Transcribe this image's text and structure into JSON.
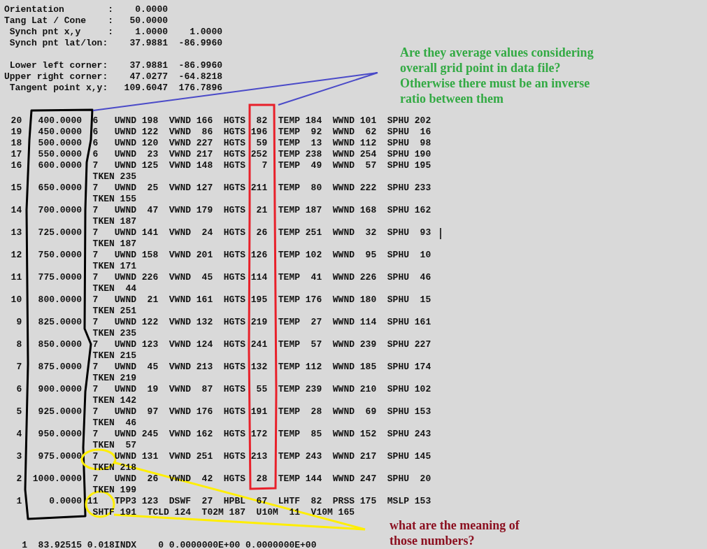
{
  "projection": [
    {
      "label": "Orientation        :",
      "values": [
        "0.0000"
      ]
    },
    {
      "label": "Tang Lat / Cone    :",
      "values": [
        "50.0000"
      ]
    },
    {
      "label": " Synch pnt x,y     :",
      "values": [
        "1.0000",
        "1.0000"
      ]
    },
    {
      "label": " Synch pnt lat/lon:",
      "values": [
        "37.9881",
        "-86.9960"
      ]
    }
  ],
  "corners": [
    {
      "label": " Lower left corner:",
      "values": [
        "37.9881",
        "-86.9960"
      ]
    },
    {
      "label": "Upper right corner:",
      "values": [
        "47.0277",
        "-64.8218"
      ]
    },
    {
      "label": " Tangent point x,y:",
      "values": [
        "109.6047",
        "176.7896"
      ]
    }
  ],
  "levels": [
    {
      "index": "20",
      "pressure": "400.0000",
      "count": "6",
      "fields": [
        {
          "name": "UWND",
          "value": "198"
        },
        {
          "name": "VWND",
          "value": "166"
        },
        {
          "name": "HGTS",
          "value": "82"
        },
        {
          "name": "TEMP",
          "value": "184"
        },
        {
          "name": "WWND",
          "value": "101"
        },
        {
          "name": "SPHU",
          "value": "202"
        }
      ]
    },
    {
      "index": "19",
      "pressure": "450.0000",
      "count": "6",
      "fields": [
        {
          "name": "UWND",
          "value": "122"
        },
        {
          "name": "VWND",
          "value": "86"
        },
        {
          "name": "HGTS",
          "value": "196"
        },
        {
          "name": "TEMP",
          "value": "92"
        },
        {
          "name": "WWND",
          "value": "62"
        },
        {
          "name": "SPHU",
          "value": "16"
        }
      ]
    },
    {
      "index": "18",
      "pressure": "500.0000",
      "count": "6",
      "fields": [
        {
          "name": "UWND",
          "value": "120"
        },
        {
          "name": "VWND",
          "value": "227"
        },
        {
          "name": "HGTS",
          "value": "59"
        },
        {
          "name": "TEMP",
          "value": "13"
        },
        {
          "name": "WWND",
          "value": "112"
        },
        {
          "name": "SPHU",
          "value": "98"
        }
      ]
    },
    {
      "index": "17",
      "pressure": "550.0000",
      "count": "6",
      "fields": [
        {
          "name": "UWND",
          "value": "23"
        },
        {
          "name": "VWND",
          "value": "217"
        },
        {
          "name": "HGTS",
          "value": "252"
        },
        {
          "name": "TEMP",
          "value": "238"
        },
        {
          "name": "WWND",
          "value": "254"
        },
        {
          "name": "SPHU",
          "value": "190"
        }
      ]
    },
    {
      "index": "16",
      "pressure": "600.0000",
      "count": "7",
      "fields": [
        {
          "name": "UWND",
          "value": "125"
        },
        {
          "name": "VWND",
          "value": "148"
        },
        {
          "name": "HGTS",
          "value": "7"
        },
        {
          "name": "TEMP",
          "value": "49"
        },
        {
          "name": "WWND",
          "value": "57"
        },
        {
          "name": "SPHU",
          "value": "195"
        }
      ],
      "continuation": [
        {
          "name": "TKEN",
          "value": "235"
        }
      ]
    },
    {
      "index": "15",
      "pressure": "650.0000",
      "count": "7",
      "fields": [
        {
          "name": "UWND",
          "value": "25"
        },
        {
          "name": "VWND",
          "value": "127"
        },
        {
          "name": "HGTS",
          "value": "211"
        },
        {
          "name": "TEMP",
          "value": "80"
        },
        {
          "name": "WWND",
          "value": "222"
        },
        {
          "name": "SPHU",
          "value": "233"
        }
      ],
      "continuation": [
        {
          "name": "TKEN",
          "value": "155"
        }
      ]
    },
    {
      "index": "14",
      "pressure": "700.0000",
      "count": "7",
      "fields": [
        {
          "name": "UWND",
          "value": "47"
        },
        {
          "name": "VWND",
          "value": "179"
        },
        {
          "name": "HGTS",
          "value": "21"
        },
        {
          "name": "TEMP",
          "value": "187"
        },
        {
          "name": "WWND",
          "value": "168"
        },
        {
          "name": "SPHU",
          "value": "162"
        }
      ],
      "continuation": [
        {
          "name": "TKEN",
          "value": "187"
        }
      ]
    },
    {
      "index": "13",
      "pressure": "725.0000",
      "count": "7",
      "fields": [
        {
          "name": "UWND",
          "value": "141"
        },
        {
          "name": "VWND",
          "value": "24"
        },
        {
          "name": "HGTS",
          "value": "26"
        },
        {
          "name": "TEMP",
          "value": "251"
        },
        {
          "name": "WWND",
          "value": "32"
        },
        {
          "name": "SPHU",
          "value": "93"
        }
      ],
      "continuation": [
        {
          "name": "TKEN",
          "value": "187"
        }
      ]
    },
    {
      "index": "12",
      "pressure": "750.0000",
      "count": "7",
      "fields": [
        {
          "name": "UWND",
          "value": "158"
        },
        {
          "name": "VWND",
          "value": "201"
        },
        {
          "name": "HGTS",
          "value": "126"
        },
        {
          "name": "TEMP",
          "value": "102"
        },
        {
          "name": "WWND",
          "value": "95"
        },
        {
          "name": "SPHU",
          "value": "10"
        }
      ],
      "continuation": [
        {
          "name": "TKEN",
          "value": "171"
        }
      ]
    },
    {
      "index": "11",
      "pressure": "775.0000",
      "count": "7",
      "fields": [
        {
          "name": "UWND",
          "value": "226"
        },
        {
          "name": "VWND",
          "value": "45"
        },
        {
          "name": "HGTS",
          "value": "114"
        },
        {
          "name": "TEMP",
          "value": "41"
        },
        {
          "name": "WWND",
          "value": "226"
        },
        {
          "name": "SPHU",
          "value": "46"
        }
      ],
      "continuation": [
        {
          "name": "TKEN",
          "value": "44"
        }
      ]
    },
    {
      "index": "10",
      "pressure": "800.0000",
      "count": "7",
      "fields": [
        {
          "name": "UWND",
          "value": "21"
        },
        {
          "name": "VWND",
          "value": "161"
        },
        {
          "name": "HGTS",
          "value": "195"
        },
        {
          "name": "TEMP",
          "value": "176"
        },
        {
          "name": "WWND",
          "value": "180"
        },
        {
          "name": "SPHU",
          "value": "15"
        }
      ],
      "continuation": [
        {
          "name": "TKEN",
          "value": "251"
        }
      ]
    },
    {
      "index": "9",
      "pressure": "825.0000",
      "count": "7",
      "fields": [
        {
          "name": "UWND",
          "value": "122"
        },
        {
          "name": "VWND",
          "value": "132"
        },
        {
          "name": "HGTS",
          "value": "219"
        },
        {
          "name": "TEMP",
          "value": "27"
        },
        {
          "name": "WWND",
          "value": "114"
        },
        {
          "name": "SPHU",
          "value": "161"
        }
      ],
      "continuation": [
        {
          "name": "TKEN",
          "value": "235"
        }
      ]
    },
    {
      "index": "8",
      "pressure": "850.0000",
      "count": "7",
      "fields": [
        {
          "name": "UWND",
          "value": "123"
        },
        {
          "name": "VWND",
          "value": "124"
        },
        {
          "name": "HGTS",
          "value": "241"
        },
        {
          "name": "TEMP",
          "value": "57"
        },
        {
          "name": "WWND",
          "value": "239"
        },
        {
          "name": "SPHU",
          "value": "227"
        }
      ],
      "continuation": [
        {
          "name": "TKEN",
          "value": "215"
        }
      ]
    },
    {
      "index": "7",
      "pressure": "875.0000",
      "count": "7",
      "fields": [
        {
          "name": "UWND",
          "value": "45"
        },
        {
          "name": "VWND",
          "value": "213"
        },
        {
          "name": "HGTS",
          "value": "132"
        },
        {
          "name": "TEMP",
          "value": "112"
        },
        {
          "name": "WWND",
          "value": "185"
        },
        {
          "name": "SPHU",
          "value": "174"
        }
      ],
      "continuation": [
        {
          "name": "TKEN",
          "value": "219"
        }
      ]
    },
    {
      "index": "6",
      "pressure": "900.0000",
      "count": "7",
      "fields": [
        {
          "name": "UWND",
          "value": "19"
        },
        {
          "name": "VWND",
          "value": "87"
        },
        {
          "name": "HGTS",
          "value": "55"
        },
        {
          "name": "TEMP",
          "value": "239"
        },
        {
          "name": "WWND",
          "value": "210"
        },
        {
          "name": "SPHU",
          "value": "102"
        }
      ],
      "continuation": [
        {
          "name": "TKEN",
          "value": "142"
        }
      ]
    },
    {
      "index": "5",
      "pressure": "925.0000",
      "count": "7",
      "fields": [
        {
          "name": "UWND",
          "value": "97"
        },
        {
          "name": "VWND",
          "value": "176"
        },
        {
          "name": "HGTS",
          "value": "191"
        },
        {
          "name": "TEMP",
          "value": "28"
        },
        {
          "name": "WWND",
          "value": "69"
        },
        {
          "name": "SPHU",
          "value": "153"
        }
      ],
      "continuation": [
        {
          "name": "TKEN",
          "value": "46"
        }
      ]
    },
    {
      "index": "4",
      "pressure": "950.0000",
      "count": "7",
      "fields": [
        {
          "name": "UWND",
          "value": "245"
        },
        {
          "name": "VWND",
          "value": "162"
        },
        {
          "name": "HGTS",
          "value": "172"
        },
        {
          "name": "TEMP",
          "value": "85"
        },
        {
          "name": "WWND",
          "value": "152"
        },
        {
          "name": "SPHU",
          "value": "243"
        }
      ],
      "continuation": [
        {
          "name": "TKEN",
          "value": "57"
        }
      ]
    },
    {
      "index": "3",
      "pressure": "975.0000",
      "count": "7",
      "fields": [
        {
          "name": "UWND",
          "value": "131"
        },
        {
          "name": "VWND",
          "value": "251"
        },
        {
          "name": "HGTS",
          "value": "213"
        },
        {
          "name": "TEMP",
          "value": "243"
        },
        {
          "name": "WWND",
          "value": "217"
        },
        {
          "name": "SPHU",
          "value": "145"
        }
      ],
      "continuation": [
        {
          "name": "TKEN",
          "value": "218"
        }
      ]
    },
    {
      "index": "2",
      "pressure": "1000.0000",
      "count": "7",
      "fields": [
        {
          "name": "UWND",
          "value": "26"
        },
        {
          "name": "VWND",
          "value": "42"
        },
        {
          "name": "HGTS",
          "value": "28"
        },
        {
          "name": "TEMP",
          "value": "144"
        },
        {
          "name": "WWND",
          "value": "247"
        },
        {
          "name": "SPHU",
          "value": "20"
        }
      ],
      "continuation": [
        {
          "name": "TKEN",
          "value": "199"
        }
      ]
    },
    {
      "index": "1",
      "pressure": "0.0000",
      "count": "11",
      "fields": [
        {
          "name": "TPP3",
          "value": "123"
        },
        {
          "name": "DSWF",
          "value": "27"
        },
        {
          "name": "HPBL",
          "value": "67"
        },
        {
          "name": "LHTF",
          "value": "82"
        },
        {
          "name": "PRSS",
          "value": "175"
        },
        {
          "name": "MSLP",
          "value": "153"
        }
      ],
      "continuation": [
        {
          "name": "SHTF",
          "value": "191"
        },
        {
          "name": "TCLD",
          "value": "124"
        },
        {
          "name": "T02M",
          "value": "187"
        },
        {
          "name": "U10M",
          "value": "11"
        },
        {
          "name": "V10M",
          "value": "165"
        }
      ]
    }
  ],
  "trailing_line": "1  83.92515 0.018INDX    0 0.0000000E+00 0.0000000E+00",
  "notes": [
    {
      "text": "Are they average values considering overall grid point in data file? Otherwise there must be an inverse ratio between them",
      "color": "#33aa44"
    },
    {
      "text": "what are the meaning of those numbers?",
      "color": "#8b1020"
    }
  ]
}
